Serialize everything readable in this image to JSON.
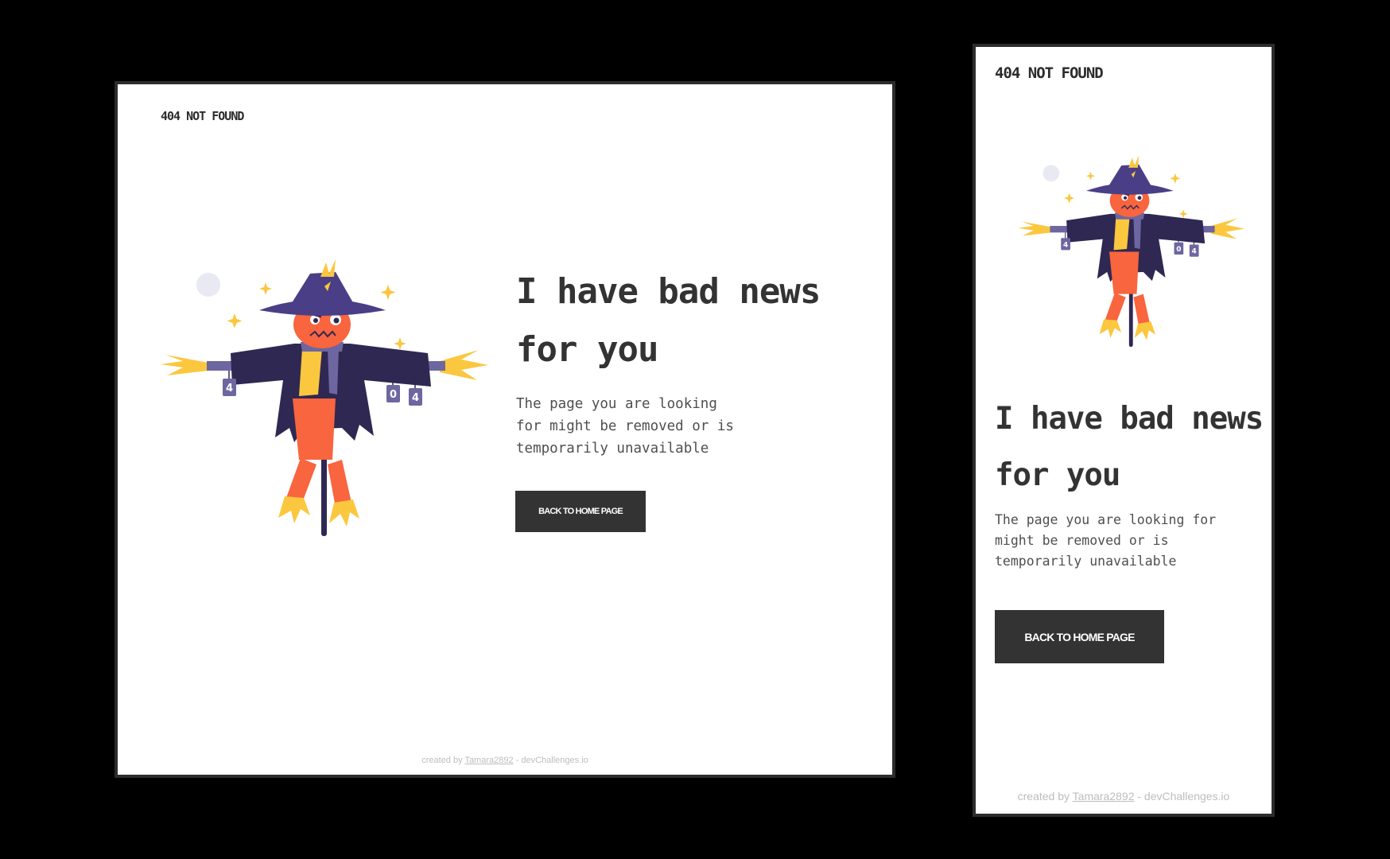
{
  "brand": "404 NOT FOUND",
  "headline": "I have bad news for you",
  "description": "The page you are looking for might be removed or is temporarily unavailable",
  "button_label": "BACK TO HOME PAGE",
  "footer": {
    "prefix": "created by",
    "author": "Tamara2892",
    "suffix": "- devChallenges.io"
  },
  "cans": [
    "4",
    "0",
    "4"
  ],
  "colors": {
    "coat": "#2f2853",
    "hat": "#4a3f86",
    "head": "#f8653e",
    "straw": "#fbc73e",
    "scarf": "#6d66a0",
    "moon": "#e8e9f2",
    "button": "#333333"
  }
}
